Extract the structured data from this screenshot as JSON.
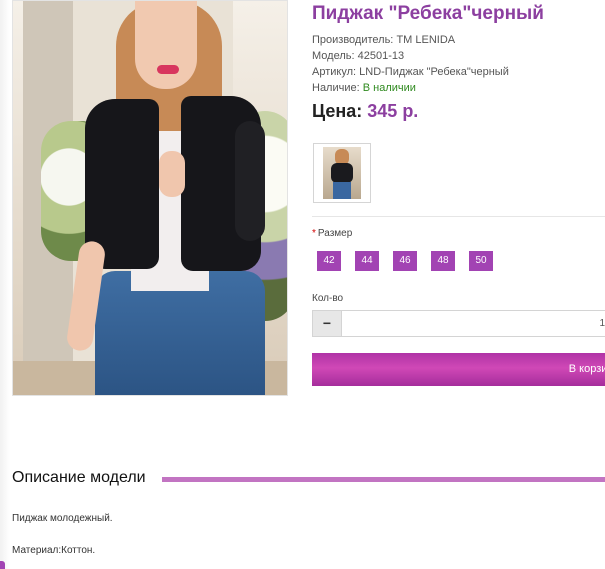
{
  "product": {
    "title": "Пиджак \"Ребека\"черный",
    "manufacturer_label": "Производитель:",
    "manufacturer": "TM LENIDA",
    "model_label": "Модель:",
    "model": "42501-13",
    "sku_label": "Артикул:",
    "sku": "LND-Пиджак \"Ребека\"черный",
    "availability_label": "Наличие:",
    "availability": "В наличии",
    "price_label": "Цена:",
    "price": "345 р."
  },
  "options": {
    "size_label": "Размер",
    "required_mark": "*",
    "sizes": [
      "42",
      "44",
      "46",
      "48",
      "50"
    ]
  },
  "quantity": {
    "label": "Кол-во",
    "minus": "−",
    "value": "1"
  },
  "cart": {
    "button_label": "В корзину"
  },
  "description": {
    "heading": "Описание модели",
    "line1": "Пиджак молодежный.",
    "line2": "Материал:Коттон."
  },
  "colors": {
    "accent": "#a243b3",
    "title": "#8c3fa0",
    "in_stock": "#2f8a1f"
  }
}
